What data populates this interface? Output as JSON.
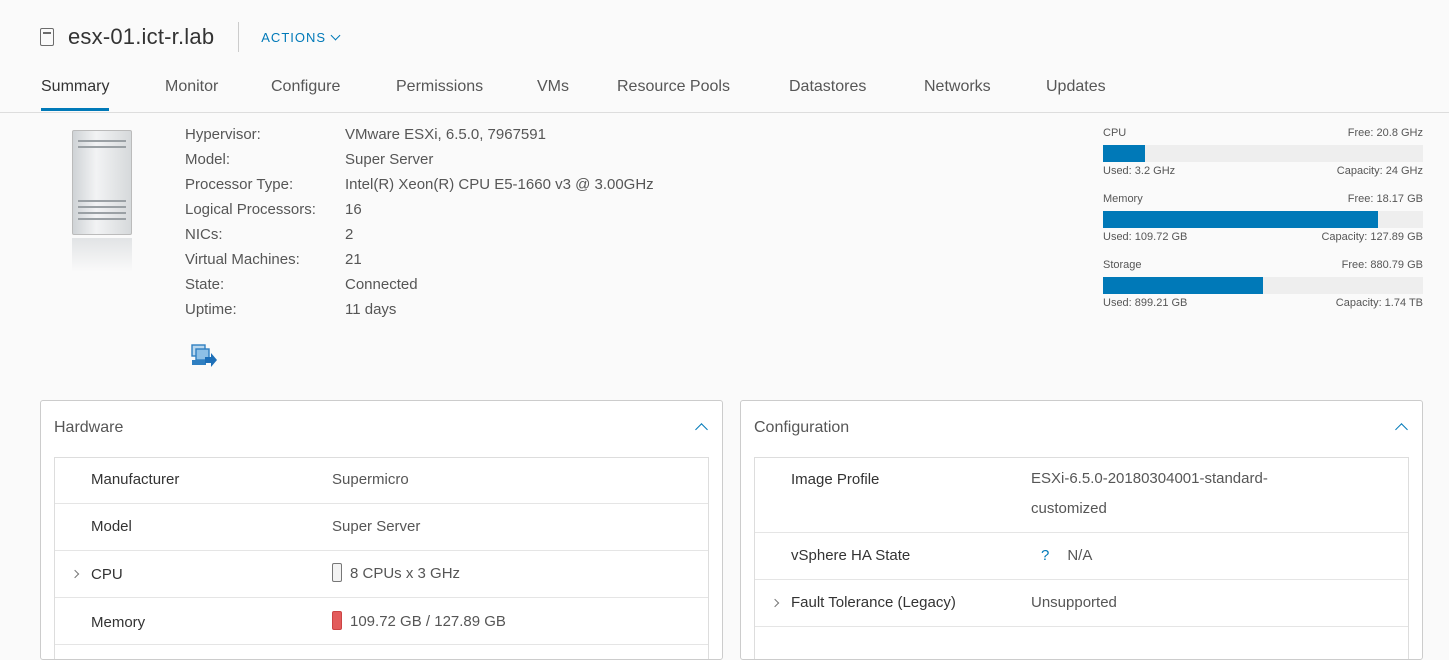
{
  "header": {
    "title": "esx-01.ict-r.lab",
    "actions_label": "ACTIONS"
  },
  "tabs": [
    "Summary",
    "Monitor",
    "Configure",
    "Permissions",
    "VMs",
    "Resource Pools",
    "Datastores",
    "Networks",
    "Updates"
  ],
  "active_tab": "Summary",
  "summary": [
    {
      "label": "Hypervisor:",
      "value": "VMware ESXi, 6.5.0, 7967591"
    },
    {
      "label": "Model:",
      "value": "Super Server"
    },
    {
      "label": "Processor Type:",
      "value": "Intel(R) Xeon(R) CPU E5-1660 v3 @ 3.00GHz"
    },
    {
      "label": "Logical Processors:",
      "value": "16"
    },
    {
      "label": "NICs:",
      "value": "2"
    },
    {
      "label": "Virtual Machines:",
      "value": "21"
    },
    {
      "label": "State:",
      "value": "Connected"
    },
    {
      "label": "Uptime:",
      "value": "11 days"
    }
  ],
  "usage": {
    "cpu": {
      "name": "CPU",
      "free": "Free: 20.8 GHz",
      "used": "Used: 3.2 GHz",
      "capacity": "Capacity: 24 GHz",
      "fraction": 0.13
    },
    "memory": {
      "name": "Memory",
      "free": "Free: 18.17 GB",
      "used": "Used: 109.72 GB",
      "capacity": "Capacity: 127.89 GB",
      "fraction": 0.858
    },
    "storage": {
      "name": "Storage",
      "free": "Free: 880.79 GB",
      "used": "Used: 899.21 GB",
      "capacity": "Capacity: 1.74 TB",
      "fraction": 0.5
    }
  },
  "hardware": {
    "title": "Hardware",
    "rows": [
      {
        "key": "Manufacturer",
        "value": "Supermicro",
        "expandable": false
      },
      {
        "key": "Model",
        "value": "Super Server",
        "expandable": false
      },
      {
        "key": "CPU",
        "value": "8 CPUs x 3 GHz",
        "expandable": true,
        "indicator": "low"
      },
      {
        "key": "Memory",
        "value": "109.72 GB / 127.89 GB",
        "expandable": false,
        "indicator": "high"
      }
    ]
  },
  "configuration": {
    "title": "Configuration",
    "rows": [
      {
        "key": "Image Profile",
        "value": "ESXi-6.5.0-20180304001-standard-",
        "value2": "customized",
        "expandable": false
      },
      {
        "key": "vSphere HA State",
        "value": "N/A",
        "help": "?",
        "expandable": false
      },
      {
        "key": "Fault Tolerance (Legacy)",
        "value": "Unsupported",
        "expandable": true
      }
    ]
  },
  "colors": {
    "accent": "#0079b8",
    "memory_high": "#e35c5c"
  }
}
